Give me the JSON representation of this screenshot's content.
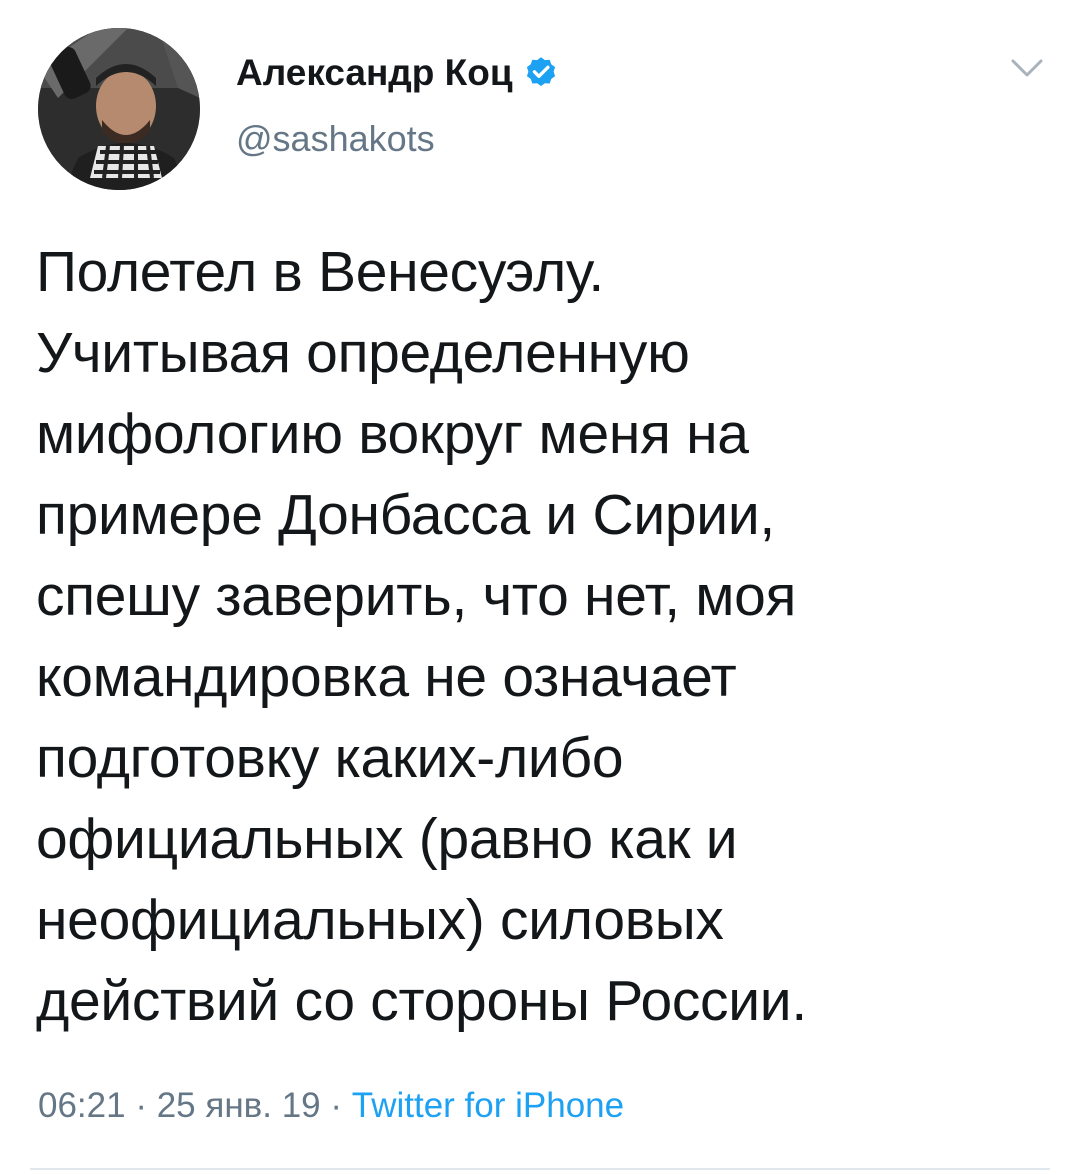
{
  "tweet": {
    "author": {
      "display_name": "Александр Коц",
      "username": "@sashakots",
      "verified": true
    },
    "text_lines": [
      "Полетел в Венесуэлу.",
      "Учитывая определенную",
      "мифологию вокруг меня на",
      "примере Донбасса и Сирии,",
      "спешу заверить, что нет, моя",
      "командировка не означает",
      "подготовку каких-либо",
      "официальных (равно как и",
      "неофициальных) силовых",
      "действий со стороны России."
    ],
    "time": "06:21",
    "separator": "·",
    "date": "25 янв. 19",
    "source": "Twitter for iPhone"
  },
  "colors": {
    "text": "#14171a",
    "secondary": "#657786",
    "link": "#1da1f2",
    "verified_badge": "#1da1f2",
    "divider": "#e1e8ed"
  },
  "icons": {
    "verified": "verified-badge-icon",
    "menu": "chevron-down-icon"
  }
}
